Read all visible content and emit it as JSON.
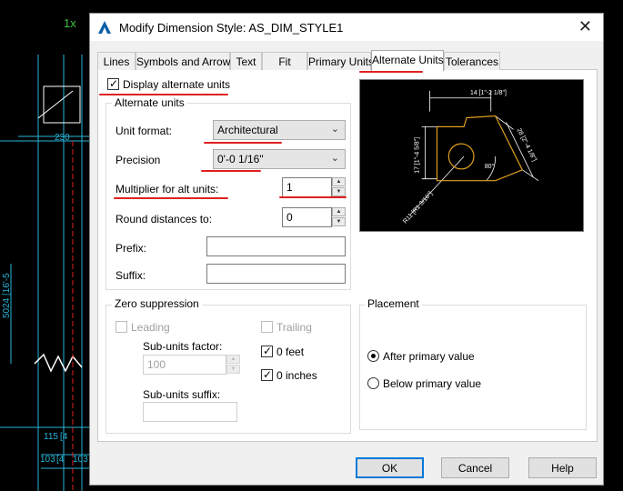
{
  "cad": {
    "layer_label": "1x",
    "dims": [
      "230",
      "5024 [16'-5",
      "115",
      "[4",
      "103",
      "[4",
      "103"
    ]
  },
  "dialog": {
    "title": "Modify Dimension Style: AS_DIM_STYLE1",
    "close_glyph": "✕"
  },
  "tabs": [
    {
      "label": "Lines"
    },
    {
      "label": "Symbols and Arrows"
    },
    {
      "label": "Text"
    },
    {
      "label": "Fit"
    },
    {
      "label": "Primary Units"
    },
    {
      "label": "Alternate Units",
      "active": true
    },
    {
      "label": "Tolerances"
    }
  ],
  "display_alt_units": {
    "label": "Display alternate units",
    "checked": true
  },
  "alternate_units": {
    "title": "Alternate units",
    "unit_format_label": "Unit format:",
    "unit_format_value": "Architectural",
    "precision_label": "Precision",
    "precision_value": "0'-0 1/16\"",
    "multiplier_label": "Multiplier for alt units:",
    "multiplier_value": "1",
    "round_label": "Round distances  to:",
    "round_value": "0",
    "prefix_label": "Prefix:",
    "prefix_value": "",
    "suffix_label": "Suffix:",
    "suffix_value": ""
  },
  "preview": {
    "dim_top": "14 [1\"-2 1/8\"]",
    "dim_left": "17 [1\"-4 5/8\"]",
    "dim_right": "28 [2\"-4 1/8\"]",
    "dim_bottom": "R11 [R1 3/16\"]",
    "angle": "80°"
  },
  "zero_suppression": {
    "title": "Zero suppression",
    "leading_label": "Leading",
    "trailing_label": "Trailing",
    "subunits_factor_label": "Sub-units factor:",
    "subunits_factor_value": "100",
    "feet_label": "0 feet",
    "inches_label": "0 inches",
    "subunits_suffix_label": "Sub-units suffix:",
    "subunits_suffix_value": ""
  },
  "placement": {
    "title": "Placement",
    "after_label": "After primary value",
    "below_label": "Below primary value",
    "selected": "after"
  },
  "buttons": {
    "ok": "OK",
    "cancel": "Cancel",
    "help": "Help"
  },
  "colors": {
    "accent": "#0078d7",
    "highlight": "#e02020",
    "cad_cyan": "#28b4d8",
    "cad_orange": "#e0a020"
  }
}
